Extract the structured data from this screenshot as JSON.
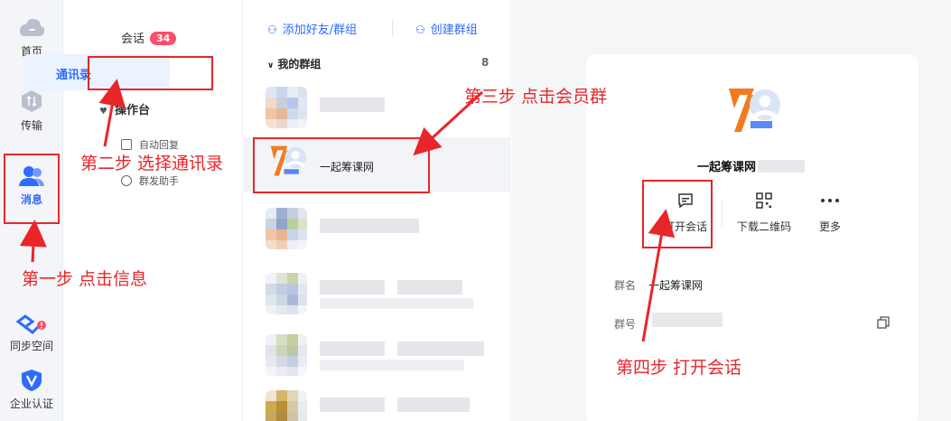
{
  "rail": {
    "items": [
      {
        "label": "首页",
        "icon": "cloud-icon"
      },
      {
        "label": "传输",
        "icon": "transfer-icon"
      },
      {
        "label": "消息",
        "icon": "contacts-icon",
        "active": true
      },
      {
        "label": "同步空间",
        "icon": "sync-space-icon"
      },
      {
        "label": "企业认证",
        "icon": "verify-shield-icon"
      }
    ]
  },
  "nav": {
    "sessions_label": "会话",
    "sessions_badge": "34",
    "contacts_label": "通讯录",
    "workbench_label": "操作台",
    "sub_items": [
      "自动回复",
      "群发助手"
    ]
  },
  "list": {
    "add_friend_label": "添加好友/群组",
    "create_group_label": "创建群组",
    "section_title": "我的群组",
    "section_count": "8",
    "selected_group_name": "一起筹课网"
  },
  "detail": {
    "title": "一起筹课网",
    "actions": [
      {
        "label": "打开会话",
        "icon": "chat-bubble-icon"
      },
      {
        "label": "下载二维码",
        "icon": "qr-code-icon"
      },
      {
        "label": "更多",
        "icon": "more-dots-icon"
      }
    ],
    "group_name_label": "群名",
    "group_name_value": "一起筹课网",
    "group_id_label": "群号"
  },
  "annotations": {
    "step1": "第一步 点击信息",
    "step2": "第二步 选择通讯录",
    "step3": "第三步 点击会员群",
    "step4": "第四步 打开会话"
  },
  "colors": {
    "accent": "#2f6bff",
    "annotation_red": "#e8262a",
    "badge": "#ff4d6a"
  }
}
